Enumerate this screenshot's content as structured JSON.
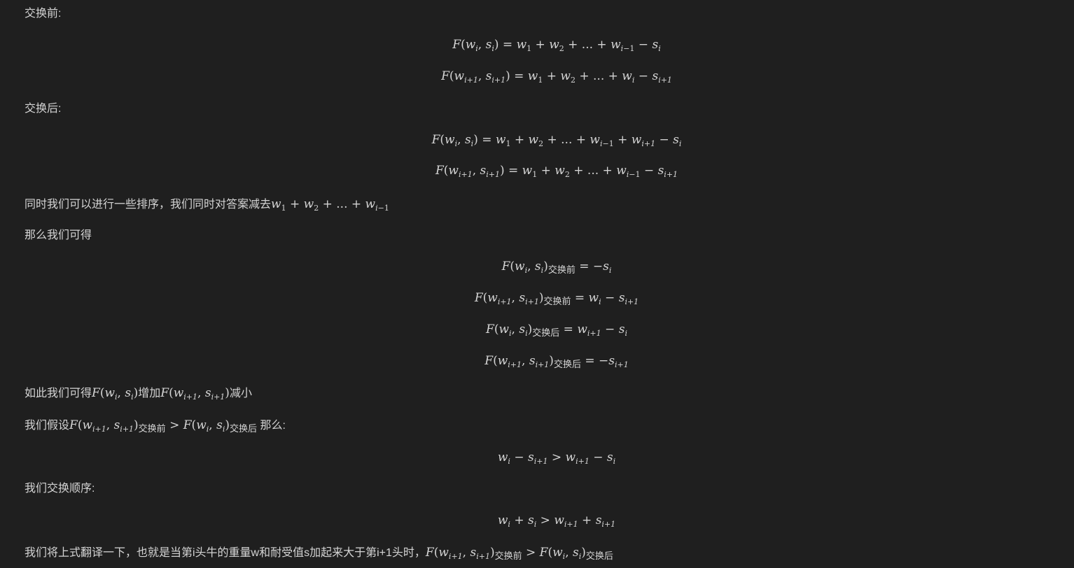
{
  "text": {
    "before_label": "交换前:",
    "after_label": "交换后:",
    "sort_sentence": "同时我们可以进行一些排序，我们同时对答案减去",
    "then_label": "那么我们可得",
    "so_prefix": "如此我们可得",
    "increase": "增加",
    "decrease": "减小",
    "assume_prefix": "我们假设",
    "assume_suffix": " 那么:",
    "swap_order": "我们交换顺序:",
    "translate": "我们将上式翻译一下，也就是当第i头牛的重量w和耐受值s加起来大于第i+1头时，",
    "sub_before": "交换前",
    "sub_after": "交换后"
  }
}
